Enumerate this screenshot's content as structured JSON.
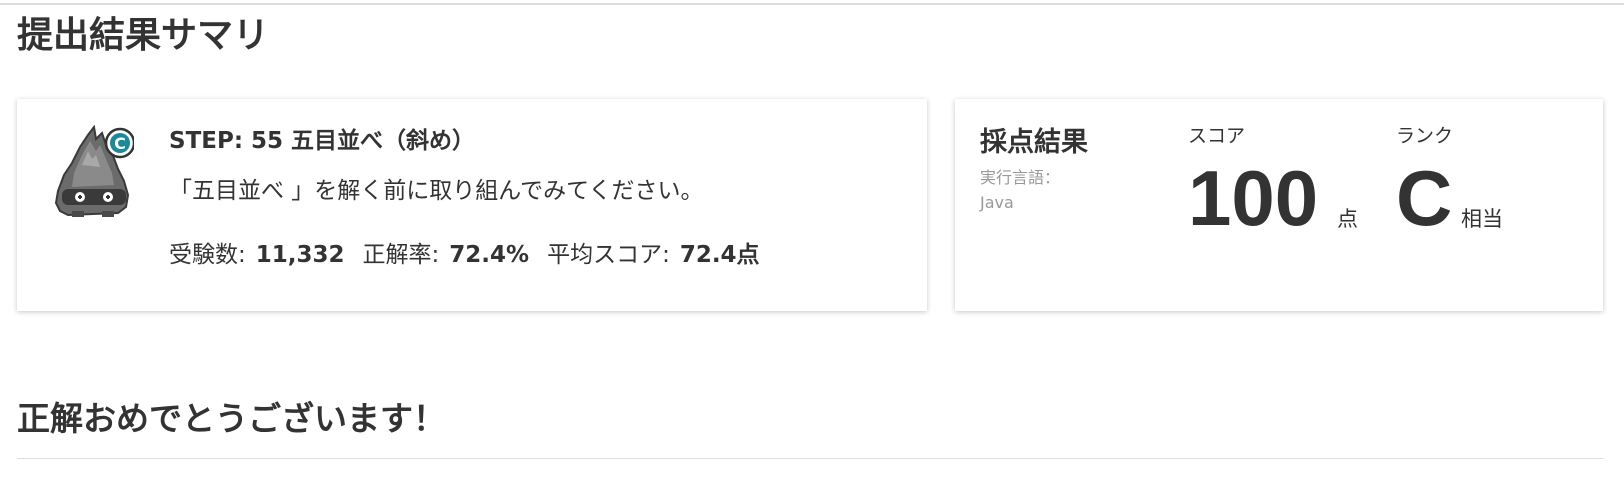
{
  "page": {
    "title": "提出結果サマリ",
    "congrats": "正解おめでとうございます！"
  },
  "problem": {
    "rank_badge": "C",
    "mascot_icon": "flame-monster-icon",
    "title": "STEP: 55 五目並べ（斜め）",
    "description": "「五目並べ 」を解く前に取り組んでみてください。",
    "stats": {
      "examinees_label": "受験数:",
      "examinees_value": "11,332",
      "accuracy_label": "正解率:",
      "accuracy_value": "72.4%",
      "avg_score_label": "平均スコア:",
      "avg_score_value": "72.4点"
    }
  },
  "result": {
    "heading": "採点結果",
    "language_label": "実行言語：",
    "language_value": "Java",
    "score_label": "スコア",
    "score_value": "100",
    "score_unit": "点",
    "rank_label": "ランク",
    "rank_value": "C",
    "rank_unit": "相当"
  },
  "colors": {
    "text": "#333333",
    "muted": "#999999",
    "badge": "#1a8a9a"
  }
}
